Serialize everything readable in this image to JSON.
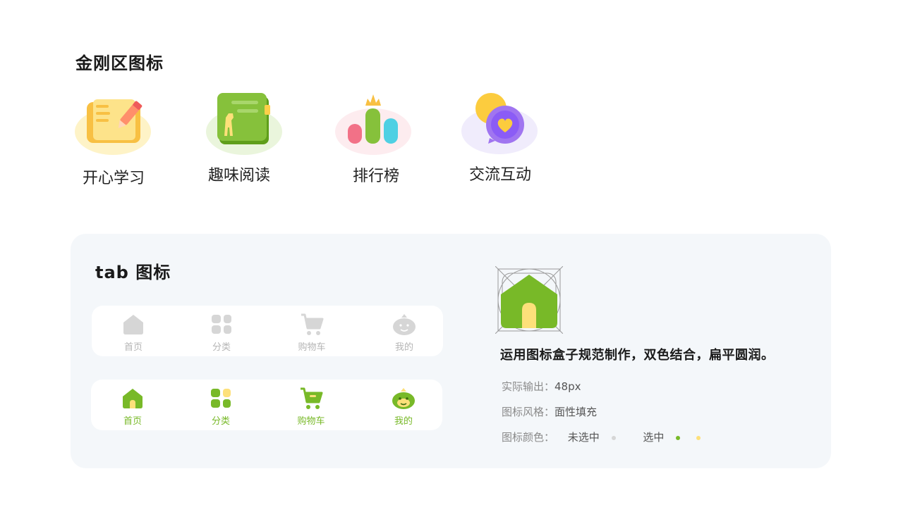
{
  "kingkong": {
    "title": "金刚区图标",
    "items": [
      {
        "label": "开心学习",
        "icon": "notebook-pencil-icon"
      },
      {
        "label": "趣味阅读",
        "icon": "giraffe-book-icon"
      },
      {
        "label": "排行榜",
        "icon": "leaderboard-crown-icon"
      },
      {
        "label": "交流互动",
        "icon": "chat-heart-icon"
      }
    ]
  },
  "tab": {
    "title": "tab 图标",
    "inactive": [
      {
        "label": "首页",
        "icon": "home-icon"
      },
      {
        "label": "分类",
        "icon": "category-icon"
      },
      {
        "label": "购物车",
        "icon": "cart-icon"
      },
      {
        "label": "我的",
        "icon": "profile-icon"
      }
    ],
    "active": [
      {
        "label": "首页",
        "icon": "home-icon"
      },
      {
        "label": "分类",
        "icon": "category-icon"
      },
      {
        "label": "购物车",
        "icon": "cart-icon"
      },
      {
        "label": "我的",
        "icon": "profile-icon"
      }
    ]
  },
  "spec": {
    "description": "运用图标盒子规范制作，双色结合，扁平圆润。",
    "output_label": "实际输出：",
    "output_value": "48px",
    "style_label": "图标风格：",
    "style_value": "面性填充",
    "color_label": "图标颜色：",
    "unselected_label": "未选中",
    "selected_label": "选中"
  },
  "colors": {
    "primary_green": "#78b928",
    "secondary_yellow": "#fde07a",
    "inactive_gray": "#d6d6d6"
  }
}
